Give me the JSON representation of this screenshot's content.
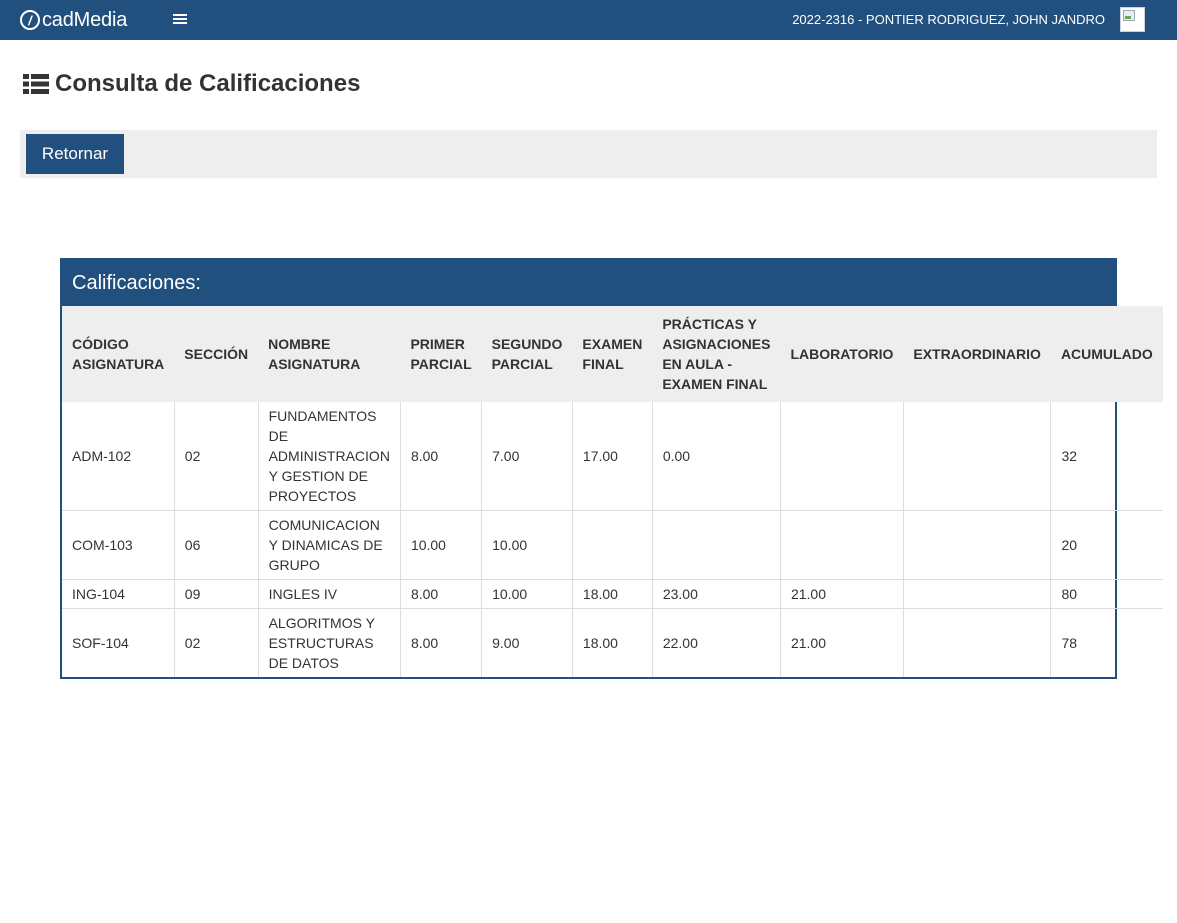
{
  "header": {
    "brand_mark": "/",
    "brand_name": "cadMedia",
    "user": "2022-2316 - PONTIER RODRIGUEZ, JOHN JANDRO"
  },
  "page": {
    "title": "Consulta de Calificaciones"
  },
  "toolbar": {
    "return_label": "Retornar"
  },
  "grades": {
    "panel_title": "Calificaciones:",
    "columns": [
      "CÓDIGO ASIGNATURA",
      "SECCIÓN",
      "NOMBRE ASIGNATURA",
      "PRIMER PARCIAL",
      "SEGUNDO PARCIAL",
      "EXAMEN FINAL",
      "PRÁCTICAS Y ASIGNACIONES EN AULA - EXAMEN FINAL",
      "LABORATORIO",
      "EXTRAORDINARIO",
      "ACUMULADO"
    ],
    "rows": [
      [
        "ADM-102",
        "02",
        "FUNDAMENTOS DE ADMINISTRACION Y GESTION DE PROYECTOS",
        "8.00",
        "7.00",
        "17.00",
        "0.00",
        "",
        "",
        "32"
      ],
      [
        "COM-103",
        "06",
        "COMUNICACION Y DINAMICAS DE GRUPO",
        "10.00",
        "10.00",
        "",
        "",
        "",
        "",
        "20"
      ],
      [
        "ING-104",
        "09",
        "INGLES IV",
        "8.00",
        "10.00",
        "18.00",
        "23.00",
        "21.00",
        "",
        "80"
      ],
      [
        "SOF-104",
        "02",
        "ALGORITMOS Y ESTRUCTURAS DE DATOS",
        "8.00",
        "9.00",
        "18.00",
        "22.00",
        "21.00",
        "",
        "78"
      ]
    ]
  },
  "colors": {
    "primary": "#22507e",
    "toolbar_bg": "#eeeeee"
  },
  "icons": [
    "menu-icon",
    "list-icon",
    "avatar-icon"
  ]
}
